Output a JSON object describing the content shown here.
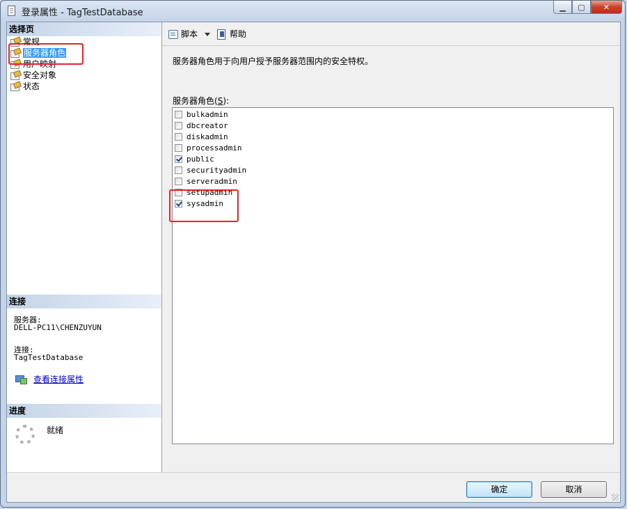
{
  "window": {
    "title": "登录属性 - TagTestDatabase",
    "minimize_glyph": "▁",
    "maximize_glyph": "▢",
    "close_glyph": "✕"
  },
  "left": {
    "select_page_heading": "选择页",
    "nav_items": [
      {
        "label": "常规",
        "icon": "page-icon"
      },
      {
        "label": "服务器角色",
        "icon": "page-icon",
        "selected": true
      },
      {
        "label": "用户映射",
        "icon": "page-icon"
      },
      {
        "label": "安全对象",
        "icon": "page-icon"
      },
      {
        "label": "状态",
        "icon": "page-icon"
      }
    ],
    "connection_heading": "连接",
    "server_label": "服务器:",
    "server_value": "DELL-PC11\\CHENZUYUN",
    "connection_label": "连接:",
    "connection_value": "TagTestDatabase",
    "view_connection_link": "查看连接属性",
    "progress_heading": "进度",
    "progress_status": "就绪"
  },
  "toolbar": {
    "script_label": "脚本",
    "help_label": "帮助"
  },
  "main": {
    "description": "服务器角色用于向用户授予服务器范围内的安全特权。",
    "roles_label_prefix": "服务器角色(",
    "roles_label_key": "S",
    "roles_label_suffix": "):",
    "roles": [
      {
        "name": "bulkadmin",
        "checked": false
      },
      {
        "name": "dbcreator",
        "checked": false
      },
      {
        "name": "diskadmin",
        "checked": false
      },
      {
        "name": "processadmin",
        "checked": false
      },
      {
        "name": "public",
        "checked": true
      },
      {
        "name": "securityadmin",
        "checked": false
      },
      {
        "name": "serveradmin",
        "checked": false
      },
      {
        "name": "setupadmin",
        "checked": false
      },
      {
        "name": "sysadmin",
        "checked": true
      }
    ]
  },
  "footer": {
    "ok_label": "确定",
    "cancel_label": "取消"
  },
  "colors": {
    "selection": "#3399ff",
    "annotation_red": "#e8222a",
    "link": "#0000cc"
  }
}
